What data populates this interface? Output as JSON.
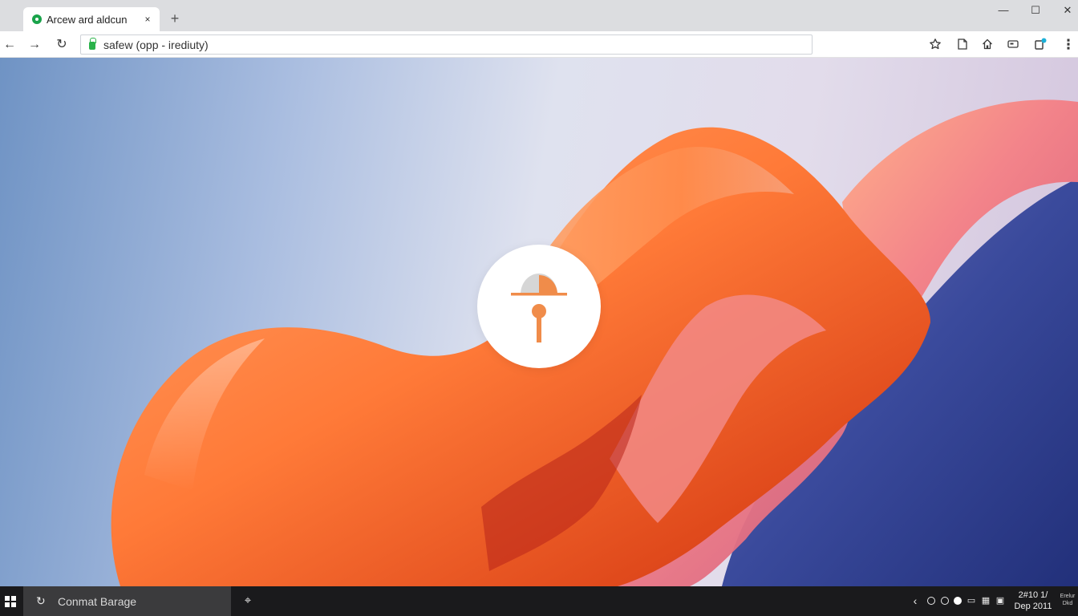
{
  "browser": {
    "tab": {
      "title": "Arcew ard aldcun",
      "close_label": "×"
    },
    "new_tab_label": "+",
    "window_controls": {
      "minimize": "—",
      "maximize": "☐",
      "close": "✕"
    },
    "nav": {
      "back": "←",
      "forward": "→",
      "reload": "↻"
    },
    "address_bar": {
      "value": "safew (opp - irediuty)"
    },
    "toolbar_icons": [
      "star-icon",
      "collections-icon",
      "home-icon",
      "wallet-icon",
      "extensions-icon",
      "more-icon"
    ],
    "more_label": "⋮"
  },
  "content": {
    "center_icon": "padlock-icon",
    "colors": {
      "orange": "#f7803a",
      "pink": "#f08a8e",
      "navy": "#2e3a8c",
      "sky": "#8fa9d6"
    }
  },
  "taskbar": {
    "search_placeholder": "Conmat Barage",
    "tray": {
      "back_chevron": "‹"
    },
    "clock": {
      "time": "2#10 1/",
      "date": "Dep 2011"
    },
    "notification": {
      "line1": "Erelur",
      "line2": "Dkd"
    }
  }
}
